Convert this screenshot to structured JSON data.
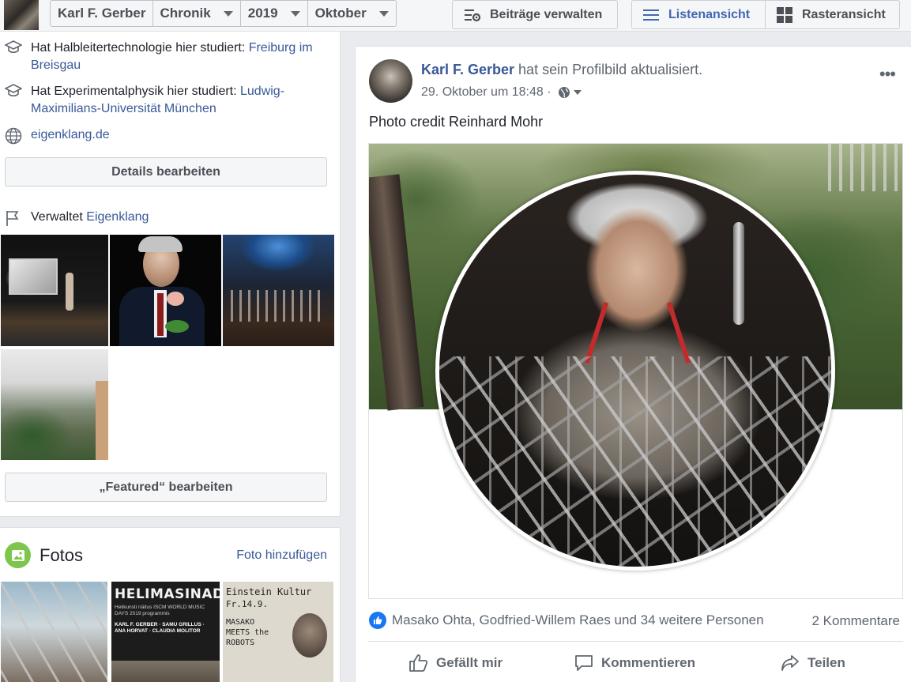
{
  "topbar": {
    "profile_name": "Karl F. Gerber",
    "section": "Chronik",
    "year": "2019",
    "month": "Oktober",
    "manage_posts": "Beiträge verwalten",
    "list_view": "Listenansicht",
    "grid_view": "Rasteransicht"
  },
  "intro": {
    "studied1_prefix": "Hat Halbleitertechnologie hier studiert: ",
    "studied1_place": "Freiburg im Breisgau",
    "studied2_prefix": "Hat Experimentalphysik hier studiert: ",
    "studied2_place": "Ludwig-Maximilians-Universität München",
    "website": "eigenklang.de",
    "edit_details": "Details bearbeiten",
    "manages_prefix": "Verwaltet ",
    "manages_page": "Eigenklang",
    "edit_featured": "„Featured“ bearbeiten"
  },
  "fotos": {
    "title": "Fotos",
    "add": "Foto hinzufügen",
    "thumb2_heading": "HELIMASINAD",
    "thumb2_sub": "Helikunsti näitus ISCM WORLD MUSIC DAYS 2019 programmis",
    "thumb2_names": "KARL F. GERBER · SAMU GRILLUS · ANA HORVAT · CLAUDIA MOLITOR",
    "thumb3_title": "Einstein Kultur",
    "thumb3_date": "Fr.14.9.",
    "thumb3_text": "MASAKO MEETS the ROBOTS"
  },
  "post": {
    "author": "Karl F. Gerber",
    "action": " hat sein Profilbild aktualisiert.",
    "timestamp": "29. Oktober um 18:48",
    "separator": " · ",
    "text": "Photo credit Reinhard Mohr",
    "reactions": "Masako Ohta, Godfried-Willem Raes und 34 weitere Personen",
    "comments": "2 Kommentare",
    "like": "Gefällt mir",
    "comment": "Kommentieren",
    "share": "Teilen",
    "more": "•••"
  },
  "colors": {
    "link": "#385898",
    "accent": "#4267b2",
    "like_blue": "#1877f2",
    "fotos_green": "#7dc54b"
  }
}
